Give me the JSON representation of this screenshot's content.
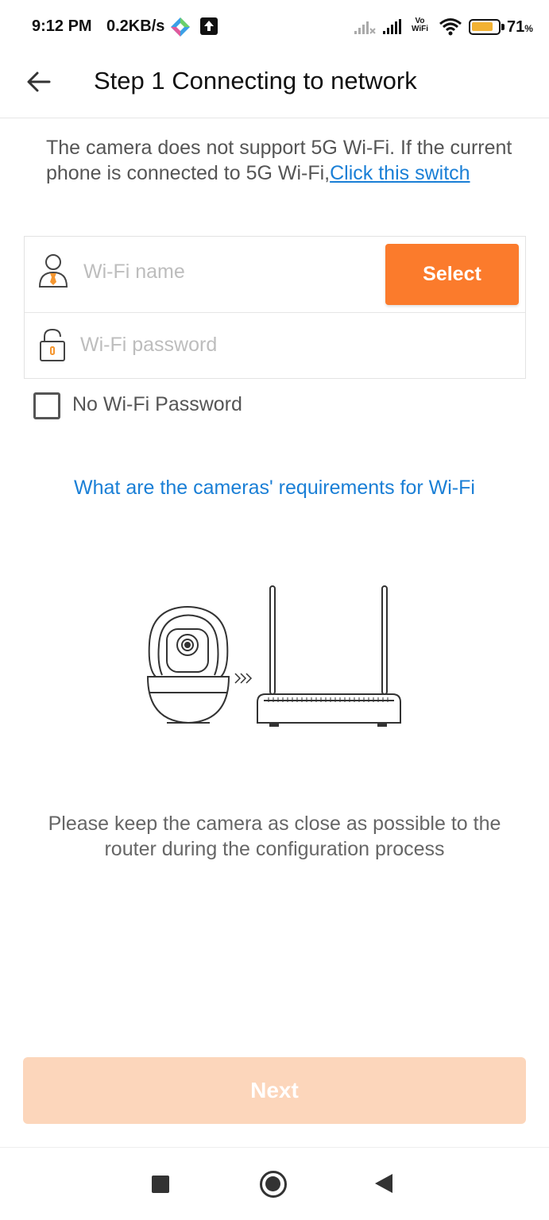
{
  "status_bar": {
    "time": "9:12 PM",
    "net_speed": "0.2KB/s",
    "vowifi_top": "Vo",
    "vowifi_bottom": "WiFi",
    "battery_percent": "71",
    "battery_unit": "%",
    "battery_level": 0.71,
    "battery_color": "#f2b233"
  },
  "header": {
    "back_icon": "arrow-left-icon",
    "title": "Step 1 Connecting to network"
  },
  "notice": {
    "text": "The camera does not support 5G Wi-Fi. If the current phone is connected to 5G Wi-Fi,",
    "link": "Click this switch"
  },
  "form": {
    "wifi_name": {
      "value": "",
      "placeholder": "Wi-Fi name",
      "icon": "user-icon"
    },
    "wifi_password": {
      "value": "",
      "placeholder": "Wi-Fi password",
      "icon": "lock-icon"
    },
    "select_label": "Select",
    "no_password_label": "No Wi-Fi Password",
    "no_password_checked": false
  },
  "requirements_link": "What are the cameras' requirements for Wi-Fi",
  "tip": "Please keep the camera as close as possible to the router during the configuration process",
  "next_label": "Next",
  "colors": {
    "accent": "#fb7b2c",
    "accent_disabled": "#fcd6bb",
    "link": "#1a7fd6"
  }
}
